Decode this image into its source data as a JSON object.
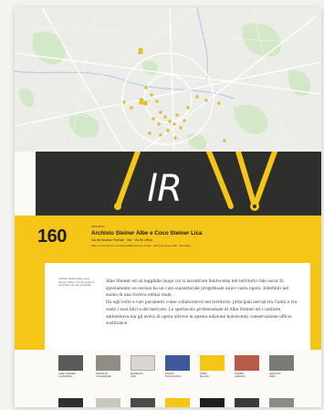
{
  "map": {
    "roads": "#ffffff",
    "parks": "#cfe6c4",
    "water": "#aac8e0",
    "pin_color": "#f5c518",
    "labels": [
      "·",
      "·",
      "·",
      "·",
      "·",
      "·",
      "·",
      "·",
      "·",
      "·",
      "·",
      "·"
    ]
  },
  "banner": {
    "logo_text": "lR",
    "accent": "#f5c518",
    "background": "#2e2e2c"
  },
  "info": {
    "number": "160",
    "kicker": "ARCHIVIO",
    "title": "Archivio Steiner Albe e Coco Steiner Lica",
    "meta_line1": "Via dei Beatrice Portinari · Ilbe · Via Re Ufficio",
    "meta_line2": "Albe e Lica Steiner con Alba Maffei Franco, Poliis · Michi Pompeo Fuffi · Mondiale"
  },
  "content": {
    "caption": "Archivio Steiner Albe e Lica Steiner, Milano. Fondo grafico e fotografico dei due progettisti.",
    "paragraph1": "Albe Steiner ed un leggibile luogo cui si incontrare bontocensi nel territorio rale oscar fu spostamento se esclusi ha un cuto suisenturale progettuale unico vasta opera. Indefiniti nel suono di una ricerca enfasi reale.",
    "paragraph2": "Ha egli volto e vari parametri come collaboratori nel territorio, principali servizi tra Cantù e tra vasto i suoi libri e del mercato. Lo spettacolo professionale di Albe Steiner ed i cantiere, ambientava ma gli aveva di opera altrove in questa edizione bonoscenti conservazione ufficio sostituisce."
  },
  "gallery": {
    "row1_captions": [
      [
        "ALBE STEINER",
        "LA MOSTRA"
      ],
      [
        "PROGETTI",
        "COLLEZIONE"
      ],
      [
        "MANIFESTI",
        "1960"
      ],
      [
        "RIVISTA",
        "POLITECNICO"
      ],
      [
        "LIBRO",
        "MILANO"
      ],
      [
        "STAMPA",
        "GRAFICA"
      ],
      [
        "ARCHIVIO",
        "LIBRI"
      ]
    ],
    "row2_captions": [
      "",
      "",
      "",
      "",
      "",
      "",
      ""
    ]
  }
}
